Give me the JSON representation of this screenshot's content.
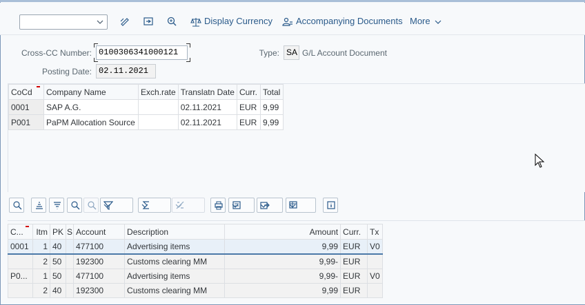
{
  "toolbar": {
    "display_currency": "Display Currency",
    "accompanying_documents": "Accompanying Documents",
    "more": "More",
    "icons": [
      "edit-icon",
      "switch-icon",
      "zoom-icon",
      "scales-icon",
      "people-doc-icon",
      "chevron-down-icon"
    ]
  },
  "header": {
    "cross_cc_label": "Cross-CC Number:",
    "cross_cc_value": "0100306341000121",
    "type_label": "Type:",
    "type_value": "SA",
    "type_desc": "G/L Account Document",
    "posting_date_label": "Posting Date:",
    "posting_date_value": "02.11.2021"
  },
  "company_grid": {
    "columns": [
      "CoCd",
      "Company Name",
      "Exch.rate",
      "Translatn Date",
      "Curr.",
      "Total"
    ],
    "rows": [
      [
        "0001",
        "SAP A.G.",
        "",
        "02.11.2021",
        "EUR",
        "9,99"
      ],
      [
        "P001",
        "PaPM Allocation Source",
        "",
        "02.11.2021",
        "EUR",
        "9,99"
      ]
    ]
  },
  "alv_toolbar_icons": [
    "details-icon",
    "sort-ascending-icon",
    "sort-descending-icon",
    "find-icon",
    "find-next-icon",
    "filter-icon",
    "sum-icon",
    "subtotal-icon",
    "print-icon",
    "view-icon",
    "export-icon",
    "layout-icon",
    "info-icon"
  ],
  "item_grid": {
    "columns": [
      "C...",
      "Itm",
      "PK",
      "S",
      "Account",
      "Description",
      "Amount",
      "Curr.",
      "Tx"
    ],
    "rows": [
      [
        "0001",
        "1",
        "40",
        "",
        "477100",
        "Advertising items",
        "9,99",
        "EUR",
        "V0"
      ],
      [
        "",
        "2",
        "50",
        "",
        "192300",
        "Customs clearing MM",
        "9,99-",
        "EUR",
        ""
      ],
      [
        "P0...",
        "1",
        "50",
        "",
        "477100",
        "Advertising items",
        "9,99-",
        "EUR",
        "V0"
      ],
      [
        "",
        "2",
        "40",
        "",
        "192300",
        "Customs clearing MM",
        "9,99",
        "EUR",
        ""
      ]
    ]
  }
}
